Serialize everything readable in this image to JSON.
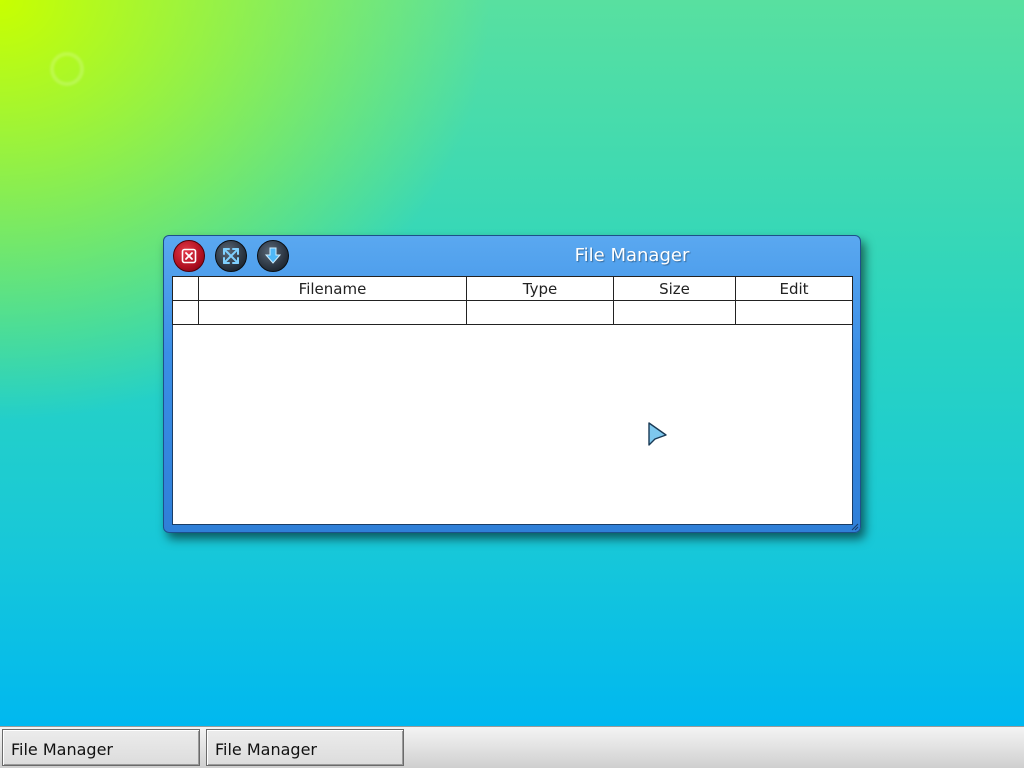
{
  "window": {
    "title": "File Manager",
    "buttons": {
      "close_icon": "close-icon",
      "maximize_icon": "maximize-arrows-icon",
      "minimize_icon": "download-arrow-icon"
    },
    "table": {
      "columns": [
        "",
        "Filename",
        "Type",
        "Size",
        "Edit"
      ],
      "rows": [
        [
          "",
          "",
          "",
          "",
          ""
        ]
      ]
    }
  },
  "taskbar": {
    "items": [
      {
        "label": "File Manager"
      },
      {
        "label": "File Manager"
      }
    ]
  },
  "colors": {
    "window_frame": "#3a8ee6",
    "close_button": "#c01828",
    "taskbar": "#e2e2e2"
  }
}
